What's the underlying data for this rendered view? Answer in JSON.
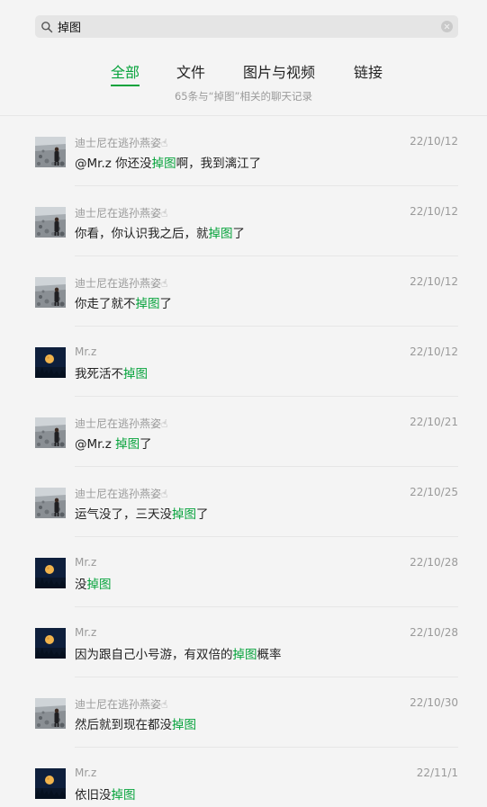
{
  "search": {
    "query": "掉图"
  },
  "tabs": [
    {
      "label": "全部",
      "active": true
    },
    {
      "label": "文件",
      "active": false
    },
    {
      "label": "图片与视频",
      "active": false
    },
    {
      "label": "链接",
      "active": false
    }
  ],
  "summary": "65条与“掉图”相关的聊天记录",
  "colors": {
    "accent": "#07a33c",
    "muted": "#9a9a9a",
    "background": "#f4f4f4"
  },
  "results": [
    {
      "avatar": "avatar-photo",
      "name": "迪士尼在逃孙燕姿☝",
      "date": "22/10/12",
      "pre": " @Mr.z 你还没",
      "hl": "掉图",
      "post": "啊，我到漓江了"
    },
    {
      "avatar": "avatar-photo",
      "name": "迪士尼在逃孙燕姿☝",
      "date": "22/10/12",
      "pre": "你看，你认识我之后，就",
      "hl": "掉图",
      "post": "了"
    },
    {
      "avatar": "avatar-photo",
      "name": "迪士尼在逃孙燕姿☝",
      "date": "22/10/12",
      "pre": "你走了就不",
      "hl": "掉图",
      "post": "了"
    },
    {
      "avatar": "avatar-moon",
      "name": "Mr.z",
      "date": "22/10/12",
      "pre": "我死活不",
      "hl": "掉图",
      "post": ""
    },
    {
      "avatar": "avatar-photo",
      "name": "迪士尼在逃孙燕姿☝",
      "date": "22/10/21",
      "pre": " @Mr.z ",
      "hl": "掉图",
      "post": "了"
    },
    {
      "avatar": "avatar-photo",
      "name": "迪士尼在逃孙燕姿☝",
      "date": "22/10/25",
      "pre": "运气没了，三天没",
      "hl": "掉图",
      "post": "了"
    },
    {
      "avatar": "avatar-moon",
      "name": "Mr.z",
      "date": "22/10/28",
      "pre": "没",
      "hl": "掉图",
      "post": ""
    },
    {
      "avatar": "avatar-moon",
      "name": "Mr.z",
      "date": "22/10/28",
      "pre": "因为跟自己小号游，有双倍的",
      "hl": "掉图",
      "post": "概率"
    },
    {
      "avatar": "avatar-photo",
      "name": "迪士尼在逃孙燕姿☝",
      "date": "22/10/30",
      "pre": "然后就到现在都没",
      "hl": "掉图",
      "post": ""
    },
    {
      "avatar": "avatar-moon",
      "name": "Mr.z",
      "date": "22/11/1",
      "pre": "依旧没",
      "hl": "掉图",
      "post": ""
    }
  ]
}
